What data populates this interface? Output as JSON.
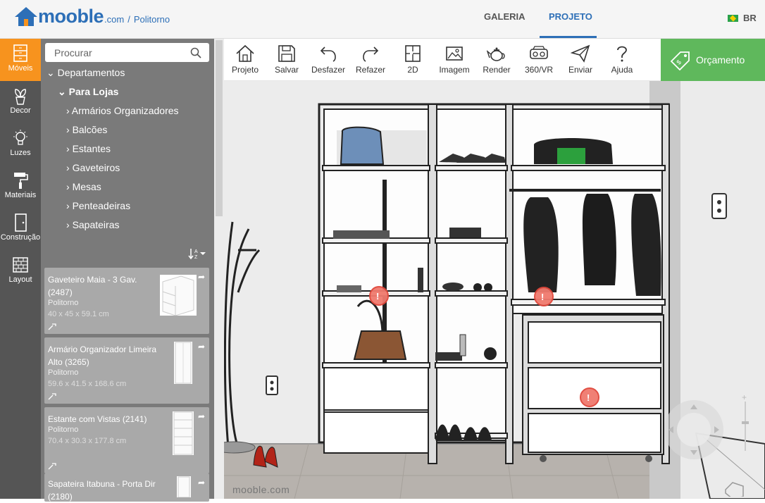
{
  "header": {
    "logo_word": "mooble",
    "logo_domain": ".com",
    "logo_separator": "/",
    "logo_store": "Politorno",
    "tabs": [
      {
        "label": "GALERIA",
        "active": false
      },
      {
        "label": "PROJETO",
        "active": true
      }
    ],
    "language": "BR",
    "accent_color": "#2d6fb7"
  },
  "sidebar_icons": [
    {
      "label": "Móveis",
      "icon": "furniture-icon",
      "active": true
    },
    {
      "label": "Decor",
      "icon": "plant-icon",
      "active": false
    },
    {
      "label": "Luzes",
      "icon": "lightbulb-icon",
      "active": false
    },
    {
      "label": "Materiais",
      "icon": "paint-roller-icon",
      "active": false
    },
    {
      "label": "Construção",
      "icon": "door-icon",
      "active": false
    },
    {
      "label": "Layout",
      "icon": "brick-wall-icon",
      "active": false
    }
  ],
  "search": {
    "placeholder": "Procurar"
  },
  "tree": {
    "root": "Departamentos",
    "group": "Para Lojas",
    "items": [
      "Armários Organizadores",
      "Balcões",
      "Estantes",
      "Gaveteiros",
      "Mesas",
      "Penteadeiras",
      "Sapateiras"
    ]
  },
  "products": [
    {
      "title": "Gaveteiro Maia - 3 Gav. (2487)",
      "brand": "Politorno",
      "dims": "40 x 45 x 59.1 cm"
    },
    {
      "title": "Armário Organizador Limeira Alto (3265)",
      "brand": "Politorno",
      "dims": "59.6 x 41.5 x 168.6 cm"
    },
    {
      "title": "Estante com Vistas (2141)",
      "brand": "Politorno",
      "dims": "70.4 x 30.3 x 177.8 cm"
    },
    {
      "title": "Sapateira Itabuna - Porta Dir (2180)",
      "brand": "",
      "dims": ""
    }
  ],
  "toolbar": {
    "buttons": [
      {
        "label": "Projeto",
        "icon": "home-icon"
      },
      {
        "label": "Salvar",
        "icon": "save-icon"
      },
      {
        "label": "Desfazer",
        "icon": "undo-icon"
      },
      {
        "label": "Refazer",
        "icon": "redo-icon"
      },
      {
        "label": "2D",
        "icon": "floorplan-icon"
      },
      {
        "label": "Imagem",
        "icon": "image-icon"
      },
      {
        "label": "Render",
        "icon": "teapot-icon"
      },
      {
        "label": "360/VR",
        "icon": "vr-headset-icon"
      },
      {
        "label": "Enviar",
        "icon": "send-icon"
      },
      {
        "label": "Ajuda",
        "icon": "help-icon"
      }
    ],
    "budget_label": "Orçamento",
    "budget_color": "#5fb85c"
  },
  "scene": {
    "watermark": "mooble.com"
  }
}
